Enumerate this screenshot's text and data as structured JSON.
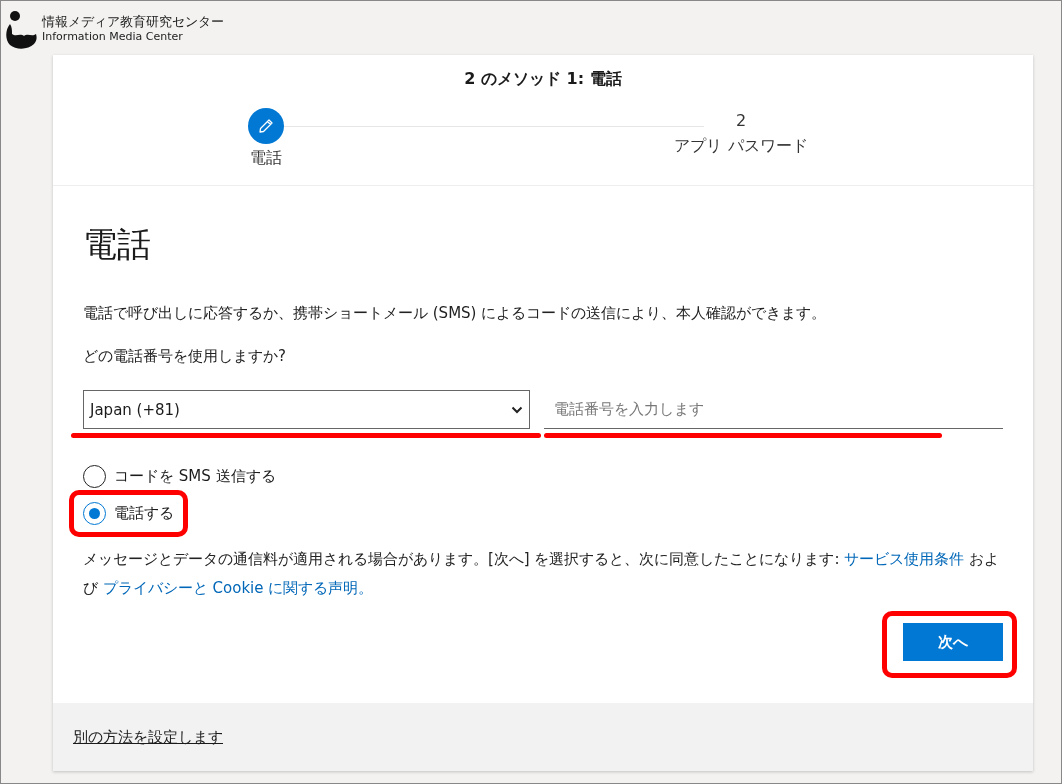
{
  "logo": {
    "title": "情報メディア教育研究センター",
    "subtitle": "Information Media Center"
  },
  "wizard": {
    "heading": "2 のメソッド 1: 電話",
    "steps": [
      {
        "kind": "icon",
        "label": "電話",
        "selected": true
      },
      {
        "kind": "number",
        "number": "2",
        "label": "アプリ パスワード",
        "selected": false
      }
    ]
  },
  "form": {
    "title": "電話",
    "description": "電話で呼び出しに応答するか、携帯ショートメール (SMS) によるコードの送信により、本人確認ができます。",
    "question": "どの電話番号を使用しますか?",
    "country_select": {
      "value": "Japan (+81)"
    },
    "phone_field": {
      "placeholder": "電話番号を入力します"
    },
    "options": [
      {
        "label": "コードを SMS 送信する",
        "selected": false
      },
      {
        "label": "電話する",
        "selected": true
      }
    ],
    "legal": [
      {
        "kind": "text",
        "text": "メッセージとデータの通信料が適用される場合があります。[次へ] を選択すると、次に同意したことになります: "
      },
      {
        "kind": "link",
        "text": "サービス使用条件"
      },
      {
        "kind": "text",
        "text": " および "
      },
      {
        "kind": "link",
        "text": "プライバシーと Cookie に関する声明。"
      }
    ],
    "next_button": "次へ"
  },
  "footer": {
    "link": "別の方法を設定します"
  }
}
